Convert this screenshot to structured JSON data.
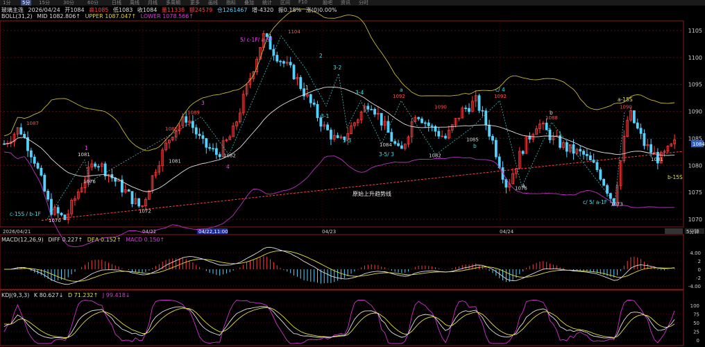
{
  "toolbar": {
    "items": [
      "1分",
      "5分",
      "15分",
      "30分",
      "60分",
      "日线",
      "周线",
      "月线",
      "多周期",
      "更多",
      "画线",
      "指标",
      "叠加",
      "统计",
      "区间",
      "F10",
      "股吧",
      "资讯",
      "分时"
    ]
  },
  "header": {
    "name": "玻璃主连",
    "date": "2026/04/24",
    "open": "开1084",
    "high": "高1085",
    "low": "低1083",
    "close": "收1084",
    "volume": "量11338",
    "amount": "额24579",
    "position": "仓1261467",
    "pos_change": "增-4320",
    "amplitude": "振0.18%",
    "change": "涨(0)0.00%"
  },
  "boll": {
    "name": "BOLL(31,2)",
    "mid": "MID 1082.806↑",
    "upper": "UPPER 1087.047↑",
    "lower": "LOWER 1078.566↑"
  },
  "macd": {
    "name": "MACD(12,26,9)",
    "diff": "DIFF 0.227↑",
    "dea": "DEA 0.152↑",
    "macd": "MACD 0.150↑"
  },
  "kdj": {
    "name": "KDJ(9,3,3)",
    "k": "K 80.627↓",
    "d": "D 71.232↑",
    "j": "J 99.418↓"
  },
  "time_axis": {
    "labels": [
      "2026/04/21",
      "04/22",
      "04/22,11:00",
      "04/23",
      "04/24"
    ],
    "period": "5分钟"
  },
  "colors": {
    "up": "#ff3b3b",
    "down": "#54d2ff",
    "mid": "#e0e0e0",
    "upper": "#c8b830",
    "lower": "#c030c8",
    "kdj_k": "#e0e0e0",
    "kdj_d": "#e0e040",
    "kdj_j": "#d030d0",
    "trend": "#ff4040",
    "wave": "#40d0d0"
  },
  "annotations": {
    "trendline_label": "原始上升趋势线",
    "current_price_tag": "1084",
    "price_labels": [
      {
        "t": "1087",
        "x": "a",
        "y": 1087
      },
      {
        "t": "1081",
        "x": "b",
        "y": 1081
      },
      {
        "t": "1076",
        "x": "c",
        "y": 1076
      },
      {
        "t": "1070",
        "x": "d",
        "y": 1070
      },
      {
        "t": "1072",
        "x": "e",
        "y": 1072
      },
      {
        "t": "1089",
        "x": "f",
        "y": 1089
      },
      {
        "t": "1086",
        "x": "g",
        "y": 1086
      },
      {
        "t": "1081",
        "x": "h",
        "y": 1081
      },
      {
        "t": "1082",
        "x": "i",
        "y": 1082
      },
      {
        "t": "1104",
        "x": "j",
        "y": 1104
      },
      {
        "t": "1092",
        "x": "k",
        "y": 1092
      },
      {
        "t": "1084",
        "x": "l",
        "y": 1084
      },
      {
        "t": "1082",
        "x": "m",
        "y": 1082
      },
      {
        "t": "1090",
        "x": "n",
        "y": 1090
      },
      {
        "t": "1085",
        "x": "o",
        "y": 1085
      },
      {
        "t": "1092",
        "x": "p",
        "y": 1092
      },
      {
        "t": "1076",
        "x": "q",
        "y": 1076
      },
      {
        "t": "1088",
        "x": "r",
        "y": 1088
      },
      {
        "t": "1090",
        "x": "s",
        "y": 1090
      },
      {
        "t": "1073",
        "x": "t",
        "y": 1073
      },
      {
        "t": "1081",
        "x": "u",
        "y": 1081
      }
    ],
    "wave_labels": [
      "c-15S / b-1F",
      "1",
      "2",
      "3",
      "4",
      "5/ c-1F/ a-5F",
      "1",
      "2",
      "3-2",
      "3-1",
      "3-3",
      "3-4",
      "3-5/ 3",
      "a",
      "b",
      "c/ 4",
      "a",
      "b",
      "c/ 5/ a-1F",
      "a-15S",
      "b-15S"
    ]
  },
  "chart_data": [
    {
      "type": "candlestick",
      "title": "",
      "y_ticks": [
        1070,
        1075,
        1080,
        1085,
        1090,
        1095,
        1100,
        1105
      ],
      "ylim": [
        1068,
        1107
      ],
      "x_ticks": [
        "2026/04/21",
        "04/22",
        "04/23",
        "04/24"
      ],
      "series": [
        {
          "name": "MID"
        },
        {
          "name": "UPPER"
        },
        {
          "name": "LOWER"
        }
      ],
      "close_approx": [
        1084,
        1087,
        1081,
        1072,
        1070,
        1076,
        1081,
        1078,
        1075,
        1072,
        1080,
        1086,
        1089,
        1084,
        1082,
        1086,
        1095,
        1104,
        1100,
        1097,
        1092,
        1087,
        1084,
        1088,
        1092,
        1087,
        1082,
        1090,
        1087,
        1085,
        1090,
        1092,
        1085,
        1076,
        1083,
        1088,
        1085,
        1083,
        1082,
        1079,
        1073,
        1090,
        1084,
        1081,
        1084
      ]
    },
    {
      "type": "bar",
      "title": "",
      "y_ticks": [
        4,
        2,
        0,
        -2,
        -4
      ],
      "y_tick_labels": [
        "4.00",
        "2",
        "0",
        "-2",
        "-4.00"
      ],
      "series": [
        {
          "name": "DIFF"
        },
        {
          "name": "DEA"
        },
        {
          "name": "MACD"
        }
      ]
    },
    {
      "type": "line",
      "title": "",
      "y_ticks": [
        100,
        75,
        50,
        25,
        0
      ],
      "series": [
        {
          "name": "K"
        },
        {
          "name": "D"
        },
        {
          "name": "J"
        }
      ]
    }
  ]
}
